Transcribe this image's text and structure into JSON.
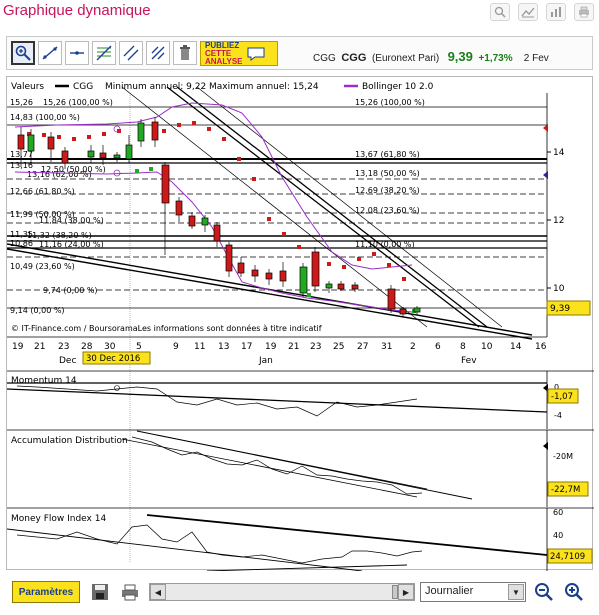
{
  "header": {
    "title": "Graphique dynamique"
  },
  "toolbar": {
    "ad_line1": "PUBLIEZ",
    "ad_line2": "CETTE",
    "ad_line3": "ANALYSE",
    "quote_ticker": "CGG",
    "quote_symbol": "CGG",
    "quote_market": "(Euronext Pari)",
    "quote_price": "9,39",
    "quote_change": "+1,73%",
    "quote_date": "2 Fev"
  },
  "legend": {
    "label": "Valeurs",
    "series": "CGG",
    "minmax": "Minimum annuel: 9,22 Maximum annuel: 15,24",
    "bollinger": "Bollinger 10 2.0"
  },
  "fib_left": [
    "15,26",
    "15,26 (100,00 %)",
    "14,83 (100,00 %)",
    "13,77",
    "13,16 (62,00 %)",
    "13,16",
    "12,50 (50,00 %)",
    "12,66 (61,80 %)",
    "11,84 (38,00 %)",
    "11,99 (50,00 %)",
    "11,35",
    "11,16 (24,00 %)",
    "11,32 (38,20 %)",
    "10,86",
    "10,49 (23,60 %)",
    "9,74 (0,00 %)",
    "9,14 (0,00 %)"
  ],
  "fib_right": [
    "15,26 (100,00 %)",
    "13,67 (61,80 %)",
    "13,18 (50,00 %)",
    "12,69 (38,20 %)",
    "12,08 (23,60 %)",
    "11,10 (0,00 %)"
  ],
  "price_axis": [
    "14",
    "12",
    "10"
  ],
  "last_price_tag": "9,39",
  "copyright": "© IT-Finance.com / BoursoramaLes informations sont données à titre indicatif",
  "x_ticks": [
    "19",
    "21",
    "23",
    "28",
    "30",
    "5",
    "9",
    "11",
    "13",
    "17",
    "19",
    "21",
    "23",
    "25",
    "27",
    "31",
    "2",
    "6",
    "8",
    "10",
    "14",
    "16"
  ],
  "x_months": {
    "dec": "Dec",
    "jan": "Jan",
    "feb": "Fev"
  },
  "cursor_date": "30 Dec 2016",
  "momentum": {
    "title": "Momentum 14",
    "axis": [
      "0",
      "-4"
    ],
    "value": "-1,07"
  },
  "accumulation": {
    "title": "Accumulation Distribution",
    "axis": [
      "-20M"
    ],
    "value": "-22,7M"
  },
  "mfi": {
    "title": "Money Flow Index 14",
    "axis": [
      "60",
      "40",
      "20"
    ],
    "value": "24,7109"
  },
  "bottom": {
    "params": "Paramètres",
    "period": "Journalier"
  },
  "colors": {
    "up": "#23a823",
    "down": "#cc1a1a",
    "bollinger": "#9a2ec8",
    "accent": "#fbe21c"
  }
}
